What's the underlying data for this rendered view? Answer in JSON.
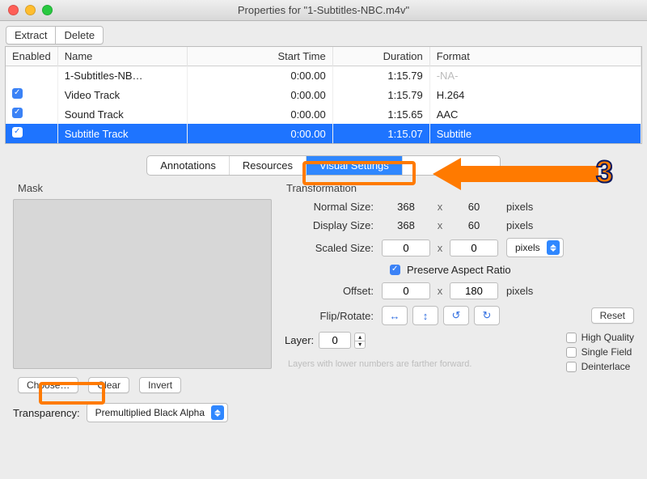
{
  "window": {
    "title": "Properties for \"1-Subtitles-NBC.m4v\""
  },
  "toolbar": {
    "extract": "Extract",
    "delete": "Delete"
  },
  "table": {
    "headers": {
      "enabled": "Enabled",
      "name": "Name",
      "start": "Start Time",
      "dur": "Duration",
      "fmt": "Format"
    },
    "rows": [
      {
        "enabled": false,
        "name": "1-Subtitles-NB…",
        "start": "0:00.00",
        "dur": "1:15.79",
        "fmt": "-NA-",
        "na": true,
        "selected": false
      },
      {
        "enabled": true,
        "name": "Video Track",
        "start": "0:00.00",
        "dur": "1:15.79",
        "fmt": "H.264",
        "selected": false
      },
      {
        "enabled": true,
        "name": "Sound Track",
        "start": "0:00.00",
        "dur": "1:15.65",
        "fmt": "AAC",
        "selected": false
      },
      {
        "enabled": true,
        "name": "Subtitle Track",
        "start": "0:00.00",
        "dur": "1:15.07",
        "fmt": "Subtitle",
        "selected": true
      }
    ]
  },
  "tabs": {
    "annotations": "Annotations",
    "resources": "Resources",
    "visual": "Visual Settings",
    "hidden": ""
  },
  "mask": {
    "title": "Mask",
    "choose": "Choose…",
    "clear": "Clear",
    "invert": "Invert"
  },
  "transparency": {
    "label": "Transparency:",
    "value": "Premultiplied Black Alpha"
  },
  "transform": {
    "title": "Transformation",
    "normal_label": "Normal Size:",
    "normal_w": "368",
    "normal_h": "60",
    "display_label": "Display Size:",
    "display_w": "368",
    "display_h": "60",
    "scaled_label": "Scaled Size:",
    "scaled_w": "0",
    "scaled_h": "0",
    "scaled_unit": "pixels",
    "preserve": "Preserve Aspect Ratio",
    "offset_label": "Offset:",
    "offset_x": "0",
    "offset_y": "180",
    "unit": "pixels",
    "x": "x",
    "fliprotate": "Flip/Rotate:",
    "reset": "Reset"
  },
  "layer": {
    "label": "Layer:",
    "value": "0",
    "help": "Layers with lower numbers are farther forward.",
    "hq": "High Quality",
    "sf": "Single Field",
    "di": "Deinterlace"
  },
  "annotation": {
    "step": "3"
  }
}
